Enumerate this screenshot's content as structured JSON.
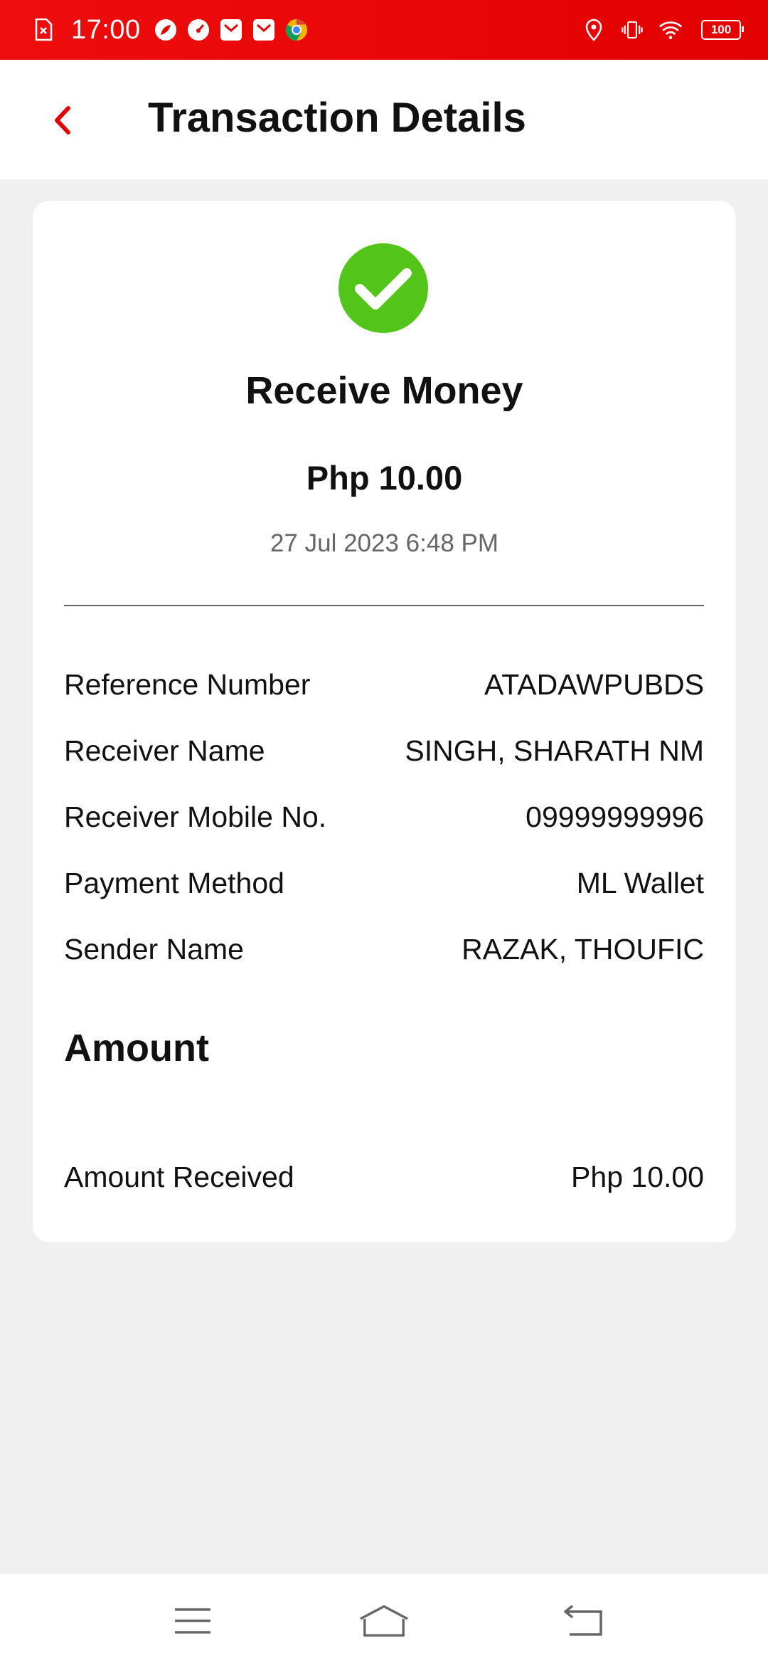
{
  "status_bar": {
    "time": "17:00",
    "battery": "100",
    "icons_left": [
      "sim-error-icon",
      "leaf-icon",
      "speedometer-icon",
      "mail-icon",
      "mail-icon",
      "chrome-icon"
    ],
    "icons_right": [
      "location-icon",
      "vibrate-icon",
      "wifi-icon",
      "battery-icon"
    ]
  },
  "header": {
    "title": "Transaction Details",
    "back_icon": "chevron-left-icon",
    "accent_color": "#e30000"
  },
  "transaction": {
    "type": "Receive Money",
    "amount": "Php 10.00",
    "datetime": "27 Jul 2023 6:48 PM",
    "status_icon": "check-circle-icon",
    "status_color": "#52c41a"
  },
  "details": [
    {
      "label": "Reference Number",
      "value": "ATADAWPUBDS"
    },
    {
      "label": "Receiver Name",
      "value": "SINGH, SHARATH NM"
    },
    {
      "label": "Receiver Mobile No.",
      "value": "09999999996"
    },
    {
      "label": "Payment Method",
      "value": "ML Wallet"
    },
    {
      "label": "Sender Name",
      "value": "RAZAK, THOUFIC"
    }
  ],
  "amount_section": {
    "title": "Amount",
    "rows": [
      {
        "label": "Amount Received",
        "value": "Php 10.00"
      }
    ]
  },
  "nav_bar": {
    "items": [
      "menu-icon",
      "home-icon",
      "back-icon"
    ]
  }
}
